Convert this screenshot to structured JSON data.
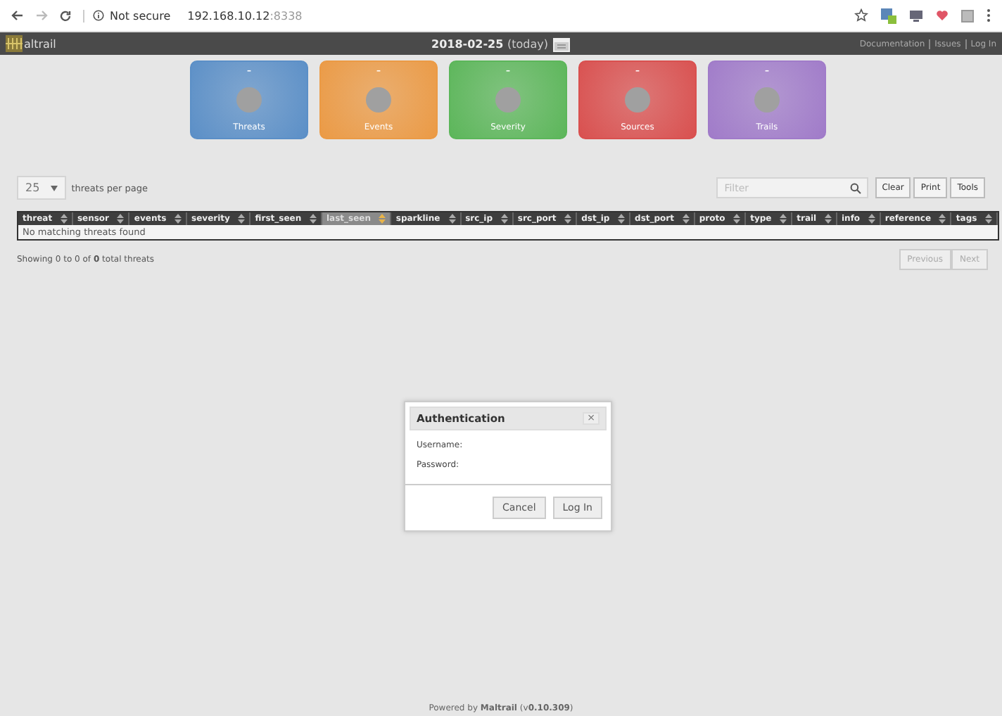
{
  "browser": {
    "security": "Not secure",
    "url_host": "192.168.10.12",
    "url_port": ":8338"
  },
  "header": {
    "logo": "altrail",
    "date": "2018-02-25",
    "date_note": "(today)",
    "links": [
      "Documentation",
      "Issues",
      "Log In"
    ]
  },
  "cards": [
    {
      "label": "Threats",
      "value": "–",
      "color": "#5b8fc7"
    },
    {
      "label": "Events",
      "value": "–",
      "color": "#eb9a45"
    },
    {
      "label": "Severity",
      "value": "–",
      "color": "#5cb65a"
    },
    {
      "label": "Sources",
      "value": "–",
      "color": "#d9504f"
    },
    {
      "label": "Trails",
      "value": "–",
      "color": "#a07bc9"
    }
  ],
  "controls": {
    "page_size": "25",
    "page_size_label": "threats per page",
    "filter_placeholder": "Filter",
    "buttons": [
      "Clear",
      "Print",
      "Tools"
    ]
  },
  "table": {
    "columns": [
      {
        "label": "threat",
        "selected": false
      },
      {
        "label": "sensor",
        "selected": false
      },
      {
        "label": "events",
        "selected": false
      },
      {
        "label": "severity",
        "selected": false
      },
      {
        "label": "first_seen",
        "selected": false
      },
      {
        "label": "last_seen",
        "selected": true
      },
      {
        "label": "sparkline",
        "selected": false
      },
      {
        "label": "src_ip",
        "selected": false
      },
      {
        "label": "src_port",
        "selected": false
      },
      {
        "label": "dst_ip",
        "selected": false
      },
      {
        "label": "dst_port",
        "selected": false
      },
      {
        "label": "proto",
        "selected": false
      },
      {
        "label": "type",
        "selected": false
      },
      {
        "label": "trail",
        "selected": false
      },
      {
        "label": "info",
        "selected": false
      },
      {
        "label": "reference",
        "selected": false
      },
      {
        "label": "tags",
        "selected": false
      }
    ],
    "empty_message": "No matching threats found"
  },
  "summary": "Showing 0 to 0 of **0** total threats",
  "pager": [
    {
      "label": "Previous",
      "disabled": true
    },
    {
      "label": "Next",
      "disabled": true
    }
  ],
  "dialog": {
    "title": "Authentication",
    "close": "×",
    "fields": [
      "Username:",
      "Password:"
    ],
    "buttons": [
      "Cancel",
      "Log In"
    ]
  },
  "footer": "Powered by **Maltrail** (v**0.10.309**)"
}
